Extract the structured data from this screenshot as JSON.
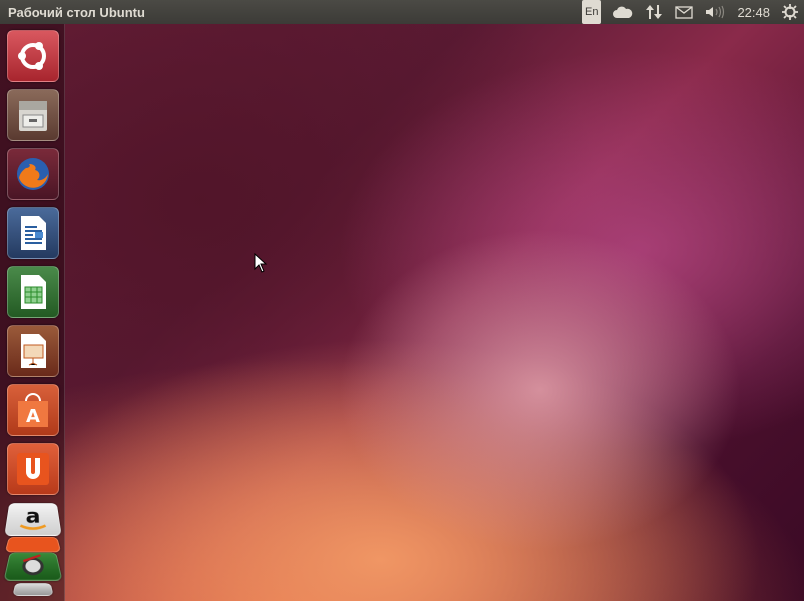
{
  "topbar": {
    "title": "Рабочий стол Ubuntu",
    "keyboard_layout": "En",
    "clock": "22:48"
  },
  "indicators": [
    "cloud-icon",
    "network-icon",
    "mail-icon",
    "volume-icon",
    "power-gear-icon"
  ],
  "launcher": {
    "items": [
      "Dash",
      "Files",
      "Firefox",
      "LibreOffice Writer",
      "LibreOffice Calc",
      "LibreOffice Impress",
      "Ubuntu Software Center",
      "Ubuntu One",
      "Amazon",
      "Ubuntu One Music",
      "Software Updater",
      "Trash"
    ]
  },
  "colors": {
    "topbar": "#3c3b37",
    "accent": "#dd4814"
  }
}
